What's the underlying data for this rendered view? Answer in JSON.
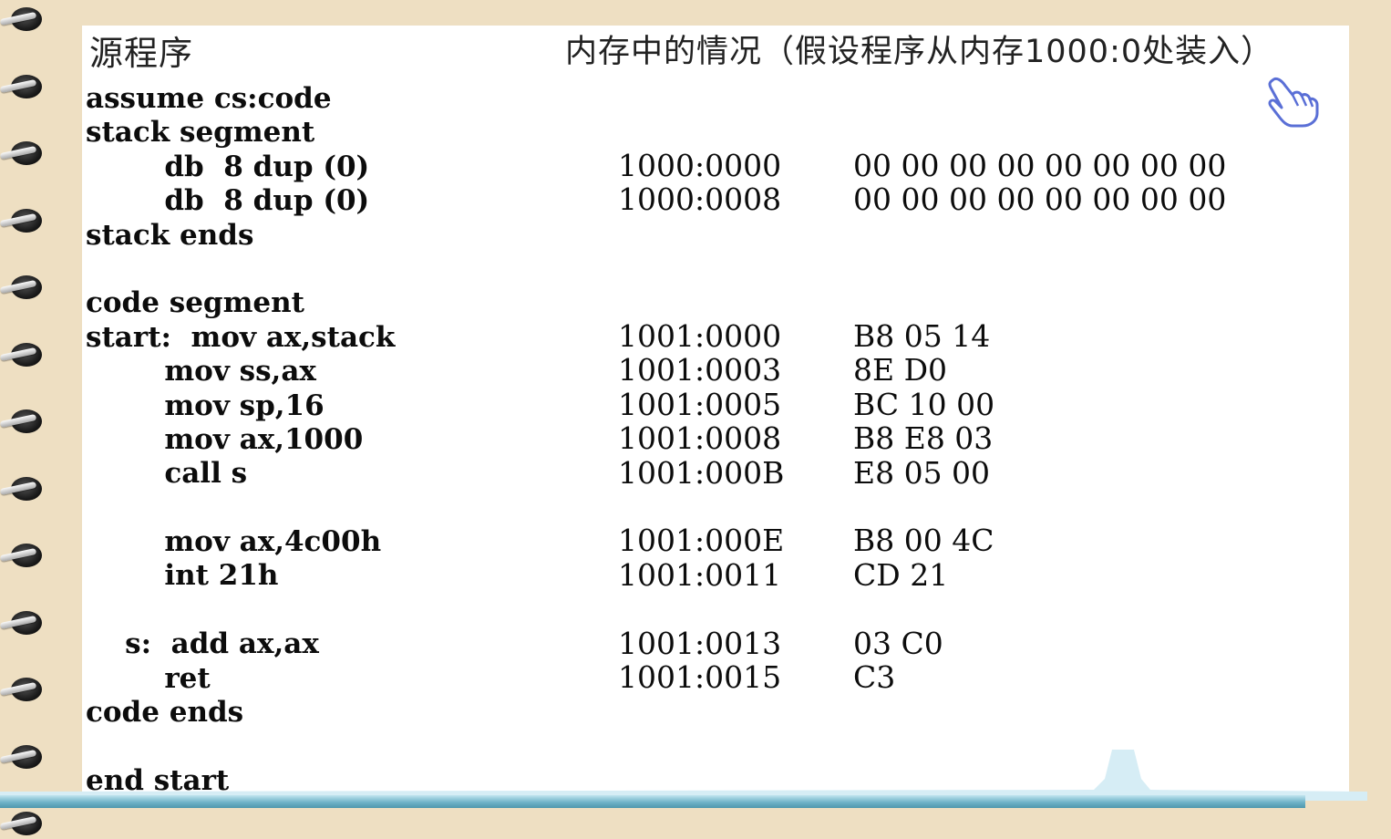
{
  "header": {
    "left": "源程序",
    "right": "内存中的情况（假设程序从内存1000:0处装入）"
  },
  "source_lines": [
    "assume cs:code",
    "stack segment",
    "        db  8 dup (0)",
    "        db  8 dup (0)",
    "stack ends",
    "",
    "code segment",
    "start:  mov ax,stack",
    "        mov ss,ax",
    "        mov sp,16",
    "        mov ax,1000",
    "        call s",
    "",
    "        mov ax,4c00h",
    "        int 21h",
    "",
    "    s:  add ax,ax",
    "        ret",
    "code ends",
    "",
    "end start"
  ],
  "memory_rows": [
    {
      "line": 2,
      "address": "1000:0000",
      "bytes": "00 00 00 00 00 00 00 00"
    },
    {
      "line": 3,
      "address": "1000:0008",
      "bytes": "00 00 00 00 00 00 00 00"
    },
    {
      "line": 7,
      "address": "1001:0000",
      "bytes": "B8 05 14"
    },
    {
      "line": 8,
      "address": "1001:0003",
      "bytes": "8E D0"
    },
    {
      "line": 9,
      "address": "1001:0005",
      "bytes": "BC 10 00"
    },
    {
      "line": 10,
      "address": "1001:0008",
      "bytes": "B8 E8 03"
    },
    {
      "line": 11,
      "address": "1001:000B",
      "bytes": "E8 05 00"
    },
    {
      "line": 13,
      "address": "1001:000E",
      "bytes": "B8 00 4C"
    },
    {
      "line": 14,
      "address": "1001:0011",
      "bytes": "CD 21"
    },
    {
      "line": 16,
      "address": "1001:0013",
      "bytes": "03 C0"
    },
    {
      "line": 17,
      "address": "1001:0015",
      "bytes": "C3"
    }
  ],
  "icons": {
    "binder_rings": "spiral-ring-icon",
    "pointer": "hand-pointer-icon"
  },
  "colors": {
    "page_background": "#eedfc2",
    "paper": "#ffffff",
    "bottom_bar": "#6fb3c8"
  }
}
